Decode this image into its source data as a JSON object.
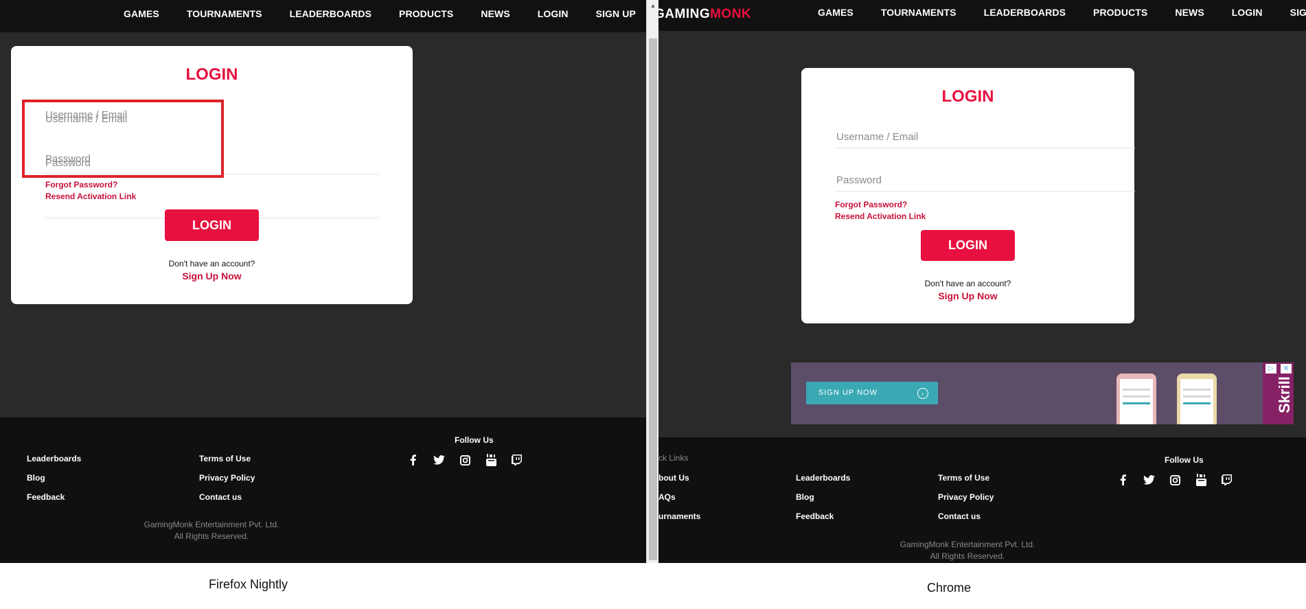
{
  "nav": {
    "items": [
      "GAMES",
      "TOURNAMENTS",
      "LEADERBOARDS",
      "PRODUCTS",
      "NEWS",
      "LOGIN",
      "SIGN UP"
    ]
  },
  "logo": {
    "part1": "GAMING",
    "part2": "MONK"
  },
  "login": {
    "title": "LOGIN",
    "username_placeholder": "Username / Email",
    "password_placeholder": "Password",
    "forgot": "Forgot Password?",
    "resend": "Resend Activation Link",
    "button": "LOGIN",
    "no_account": "Don't have an account?",
    "signup": "Sign Up Now"
  },
  "footer": {
    "follow": "Follow Us",
    "quick_links": "ck Links",
    "about": "bout Us",
    "faqs": "AQs",
    "tournaments": "urnaments",
    "leaderboards": "Leaderboards",
    "blog": "Blog",
    "feedback": "Feedback",
    "terms": "Terms of Use",
    "privacy": "Privacy Policy",
    "contact": "Contact us",
    "copyright_line1": "GamingMonk Entertainment Pvt. Ltd.",
    "copyright_line2": "All Rights Reserved."
  },
  "ad": {
    "button": "SIGN UP NOW",
    "arrow": "›",
    "brand": "Skrill",
    "adchoices": "▷",
    "close": "✕"
  },
  "social_icons": [
    "facebook-icon",
    "twitter-icon",
    "instagram-icon",
    "youtube-icon",
    "twitch-icon"
  ],
  "captions": {
    "left": "Firefox Nightly",
    "right": "Chrome"
  },
  "colors": {
    "accent": "#e8103e",
    "nav_bg": "#111111",
    "page_bg": "#2a2a2a",
    "footer_bg": "#101010",
    "highlight": "#dc2228"
  }
}
